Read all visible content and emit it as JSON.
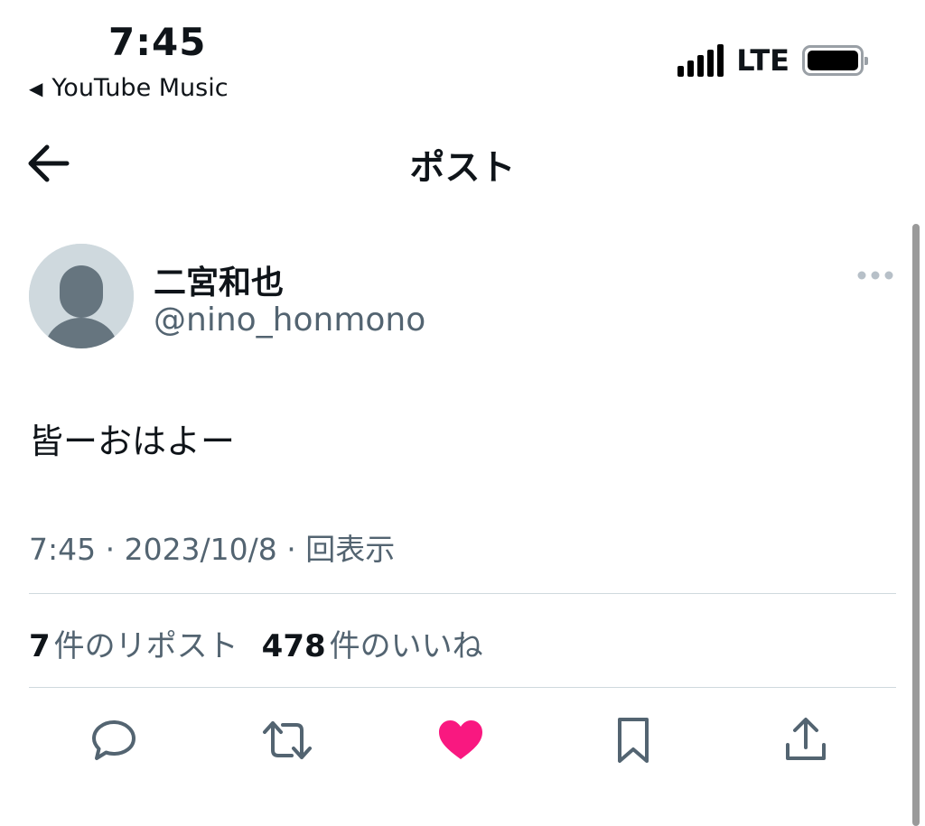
{
  "status_bar": {
    "time": "7:45",
    "back_app": "YouTube Music",
    "network": "LTE"
  },
  "header": {
    "title": "ポスト"
  },
  "post": {
    "display_name": "二宮和也",
    "handle": "@nino_honmono",
    "text": "皆ーおはよー",
    "meta": "7:45 · 2023/10/8 · 回表示"
  },
  "stats": {
    "reposts_count": "7",
    "reposts_label": "件のリポスト",
    "likes_count": "478",
    "likes_label": "件のいいね"
  },
  "icons": {
    "back": "back-arrow-icon",
    "more": "more-icon",
    "reply": "reply-icon",
    "repost": "repost-icon",
    "like": "like-heart-icon",
    "bookmark": "bookmark-icon",
    "share": "share-icon"
  },
  "colors": {
    "like_active": "#f91880",
    "secondary_text": "#536471",
    "icon": "#536471"
  }
}
